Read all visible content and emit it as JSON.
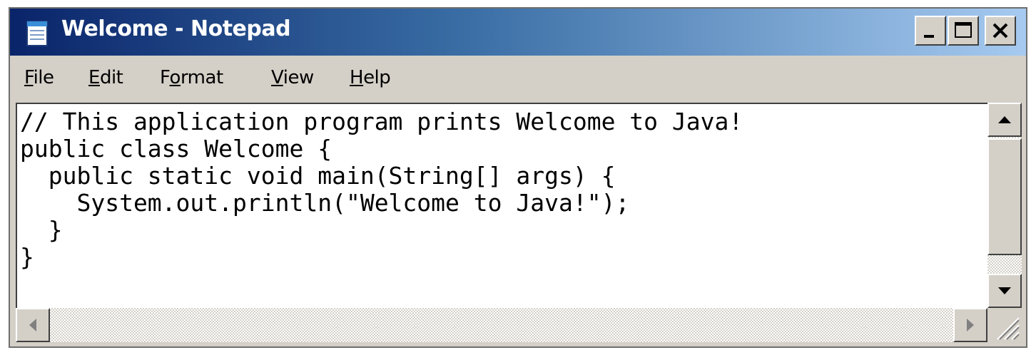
{
  "window": {
    "title": "Welcome - Notepad",
    "icon": "notepad-icon",
    "controls": {
      "minimize": "minimize-icon",
      "maximize": "maximize-icon",
      "close": "close-icon"
    }
  },
  "menu": {
    "items": [
      {
        "pre": "",
        "key": "F",
        "post": "ile"
      },
      {
        "pre": "",
        "key": "E",
        "post": "dit"
      },
      {
        "pre": "F",
        "key": "o",
        "post": "rmat"
      },
      {
        "pre": "",
        "key": "V",
        "post": "iew"
      },
      {
        "pre": "",
        "key": "H",
        "post": "elp"
      }
    ]
  },
  "editor": {
    "content": "// This application program prints Welcome to Java!\npublic class Welcome {\n  public static void main(String[] args) {\n    System.out.println(\"Welcome to Java!\");\n  }\n}"
  },
  "scrollbars": {
    "up": "arrow-up-icon",
    "down": "arrow-down-icon",
    "left": "arrow-left-icon",
    "right": "arrow-right-icon"
  },
  "colors": {
    "titlebar_start": "#0a246a",
    "titlebar_end": "#a6caf0",
    "chrome": "#d4d0c8"
  }
}
